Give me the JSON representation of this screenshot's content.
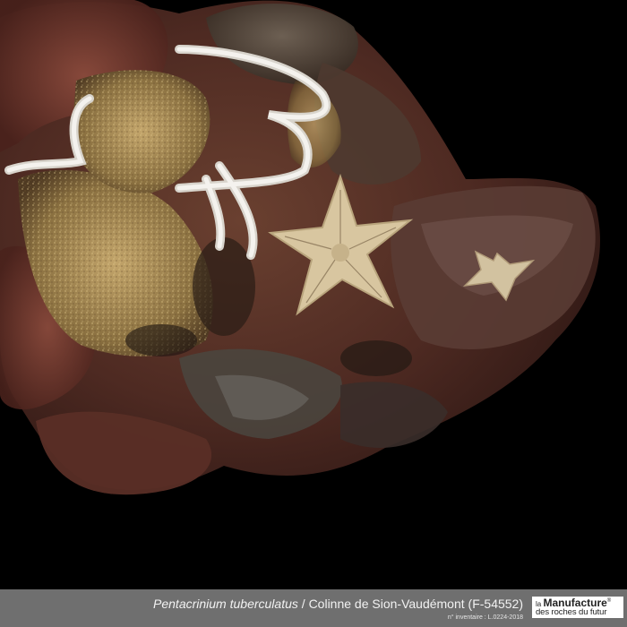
{
  "caption": {
    "species": "Pentacrinium tuberculatus",
    "separator": " / ",
    "locality": "Colinne de Sion-Vaudémont (F-54552)",
    "inventory": "n° inventaire : L.0224-2018"
  },
  "logo": {
    "prefix": "la ",
    "name": "Manufacture",
    "mark": "®",
    "line2": "des roches du futur"
  },
  "colors": {
    "background": "#000000",
    "caption_bar": "#6f6f6f",
    "logo_bg": "#ffffff"
  }
}
